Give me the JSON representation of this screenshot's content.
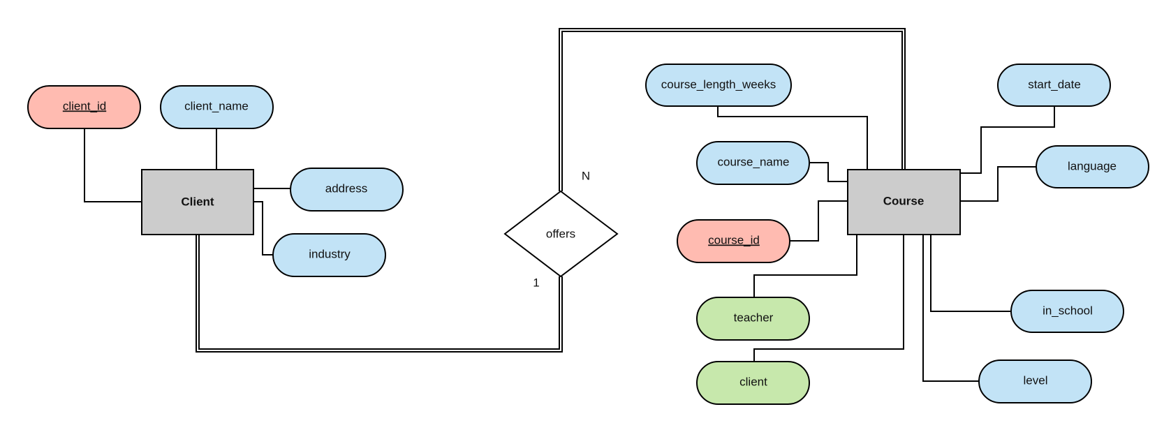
{
  "diagram": {
    "type": "er-diagram",
    "colors": {
      "entity_fill": "#cccccc",
      "attribute_fill": "#c2e3f6",
      "key_attribute_fill": "#ffbbb1",
      "foreign_attribute_fill": "#c7e8ac",
      "stroke": "#000000",
      "background": "#ffffff"
    },
    "entities": [
      {
        "id": "client",
        "label": "Client"
      },
      {
        "id": "course",
        "label": "Course"
      }
    ],
    "relationship": {
      "id": "offers",
      "label": "offers"
    },
    "cardinalities": {
      "client_side": "1",
      "course_side": "N"
    },
    "client_attributes": [
      {
        "id": "client_id",
        "label": "client_id",
        "kind": "key"
      },
      {
        "id": "client_name",
        "label": "client_name",
        "kind": "regular"
      },
      {
        "id": "address",
        "label": "address",
        "kind": "regular"
      },
      {
        "id": "industry",
        "label": "industry",
        "kind": "regular"
      }
    ],
    "course_attributes": [
      {
        "id": "course_length_weeks",
        "label": "course_length_weeks",
        "kind": "regular"
      },
      {
        "id": "course_name",
        "label": "course_name",
        "kind": "regular"
      },
      {
        "id": "course_id",
        "label": "course_id",
        "kind": "key"
      },
      {
        "id": "teacher",
        "label": "teacher",
        "kind": "foreign"
      },
      {
        "id": "client",
        "label": "client",
        "kind": "foreign"
      },
      {
        "id": "start_date",
        "label": "start_date",
        "kind": "regular"
      },
      {
        "id": "language",
        "label": "language",
        "kind": "regular"
      },
      {
        "id": "in_school",
        "label": "in_school",
        "kind": "regular"
      },
      {
        "id": "level",
        "label": "level",
        "kind": "regular"
      }
    ]
  }
}
